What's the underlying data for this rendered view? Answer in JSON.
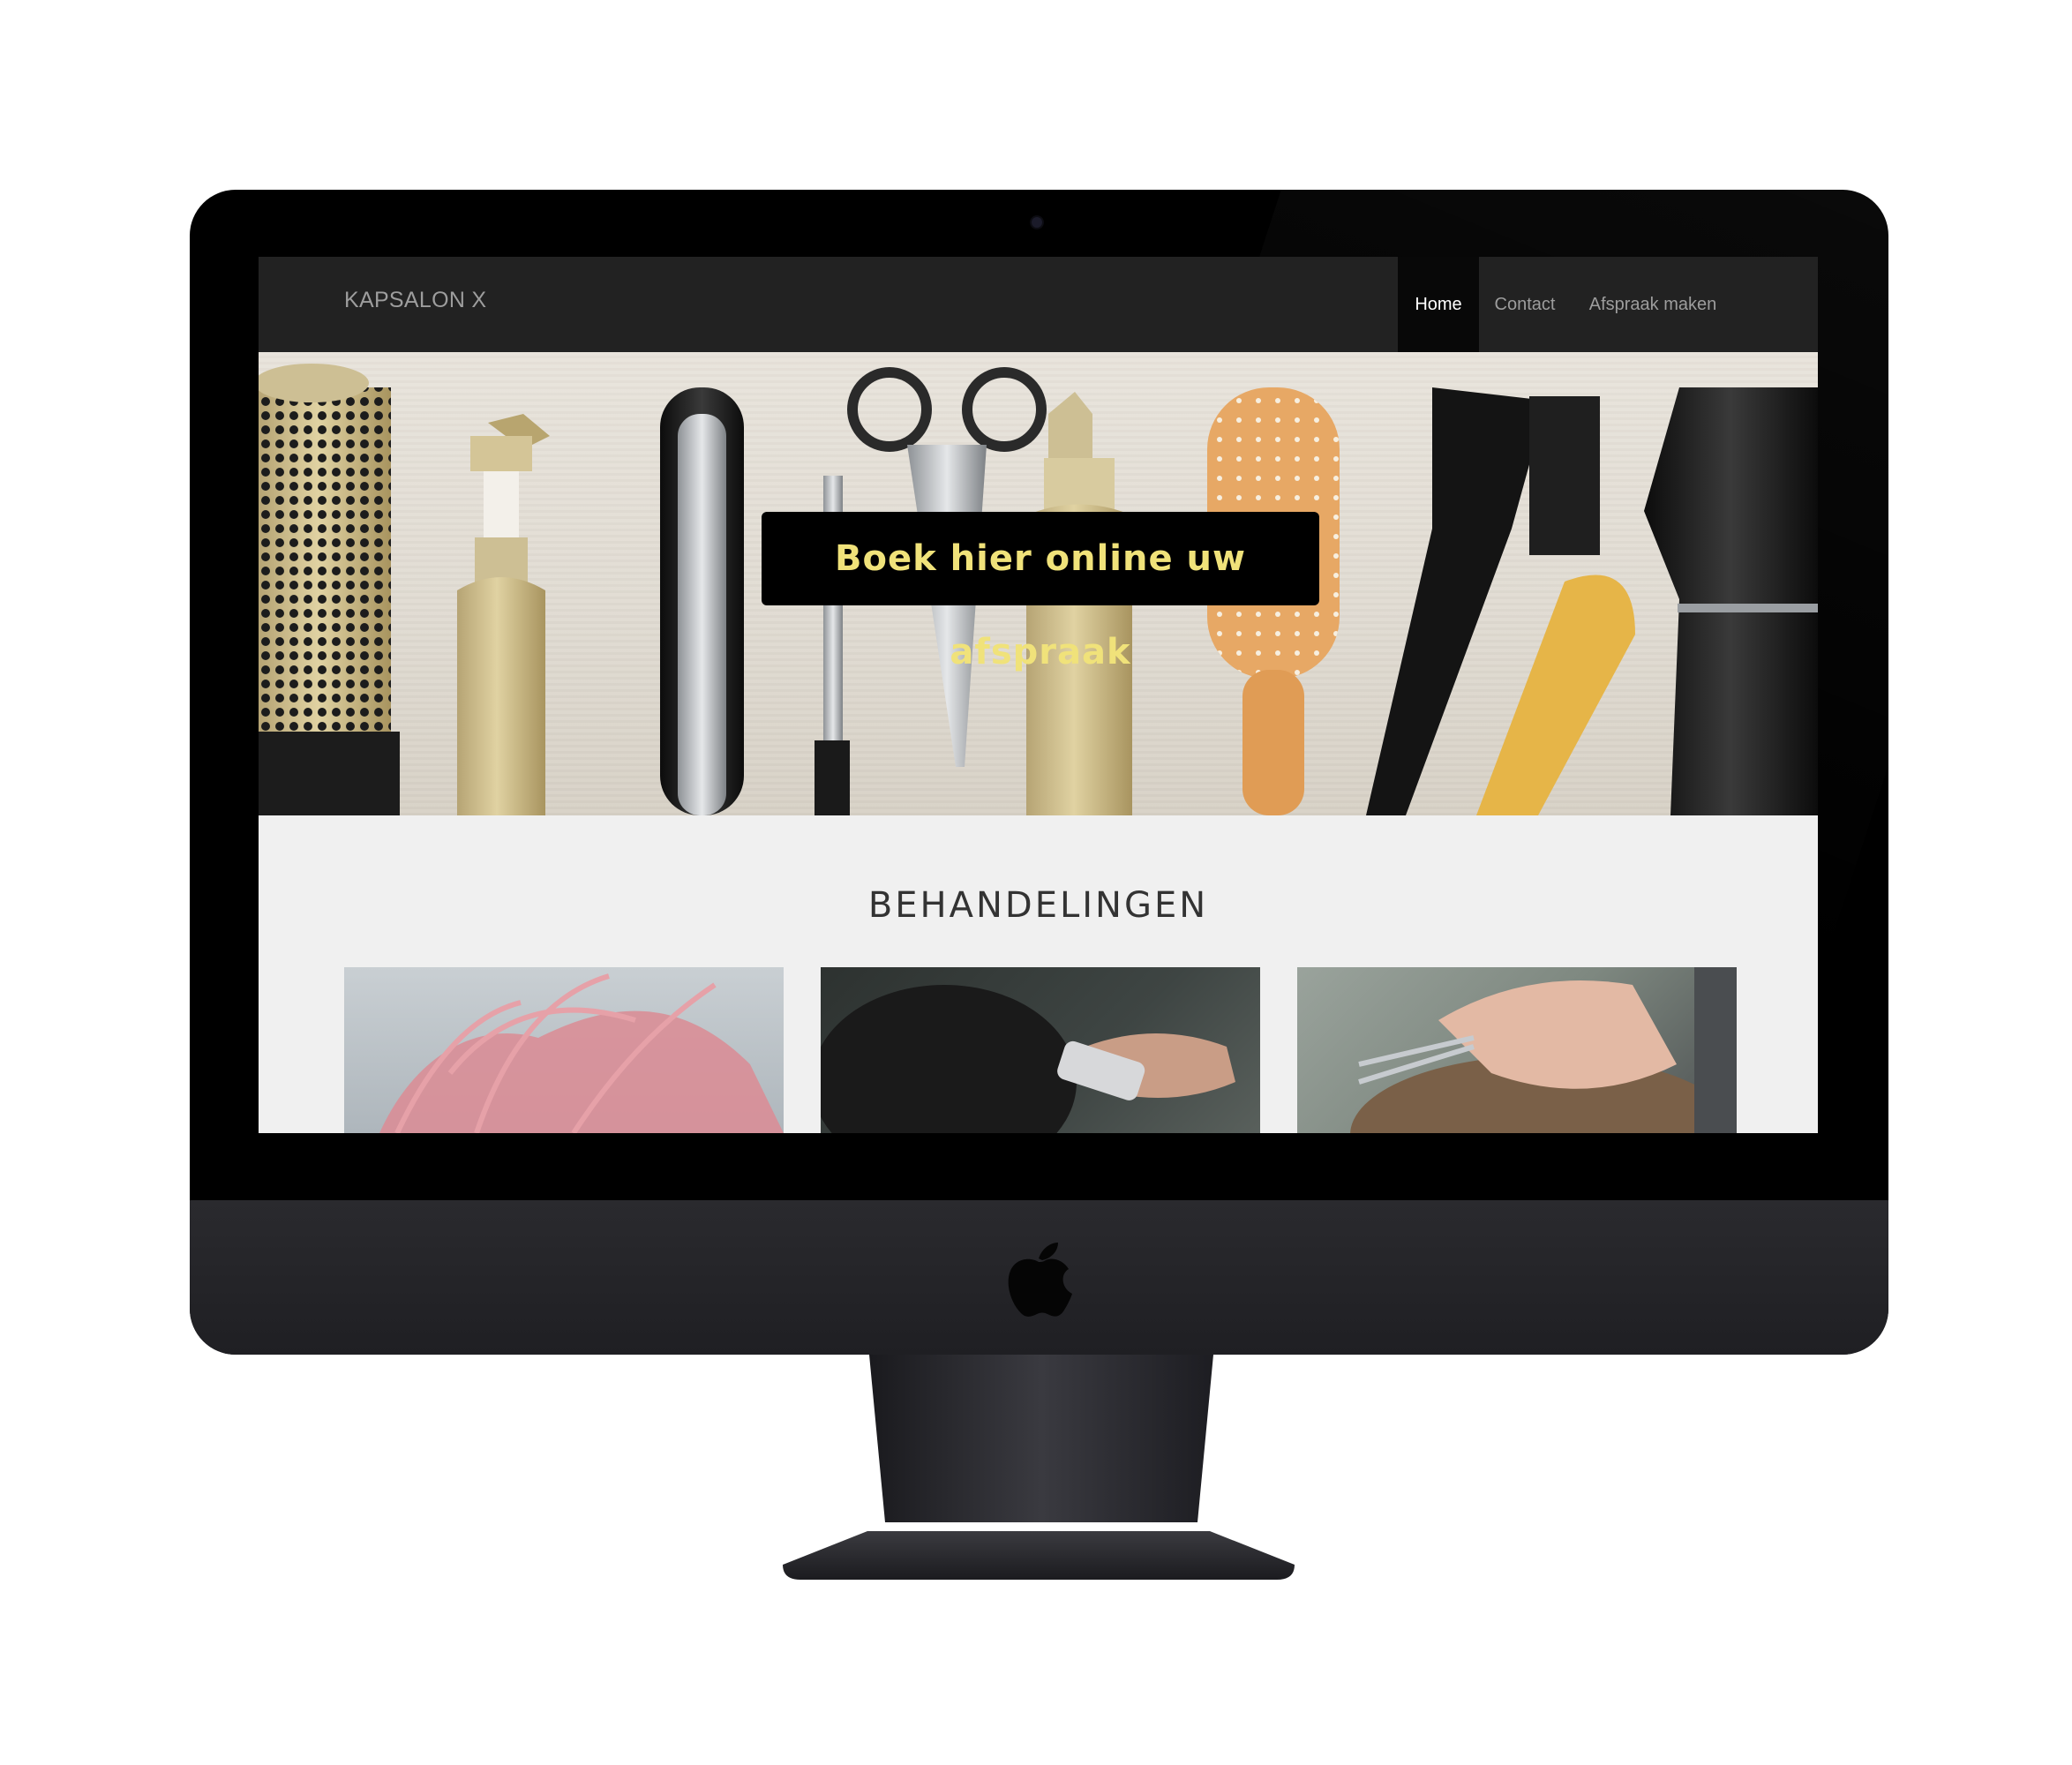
{
  "site": {
    "brand": "KAPSALON X",
    "nav": [
      {
        "label": "Home",
        "active": true
      },
      {
        "label": "Contact",
        "active": false
      },
      {
        "label": "Afspraak maken",
        "active": false
      }
    ]
  },
  "hero": {
    "cta_label": "Boek hier online uw afspraak"
  },
  "section": {
    "title": "BEHANDELINGEN",
    "cards": [
      {
        "image": "pink-hair-photo"
      },
      {
        "image": "clipper-haircut-photo"
      },
      {
        "image": "scissors-haircut-photo"
      }
    ]
  },
  "colors": {
    "navbar": "#222222",
    "nav_active": "#080808",
    "cta_bg": "#000000",
    "cta_text": "#f0e27a",
    "page_bg": "#f0f0f0"
  },
  "icons": {
    "brand_logo": "apple-logo-icon"
  }
}
